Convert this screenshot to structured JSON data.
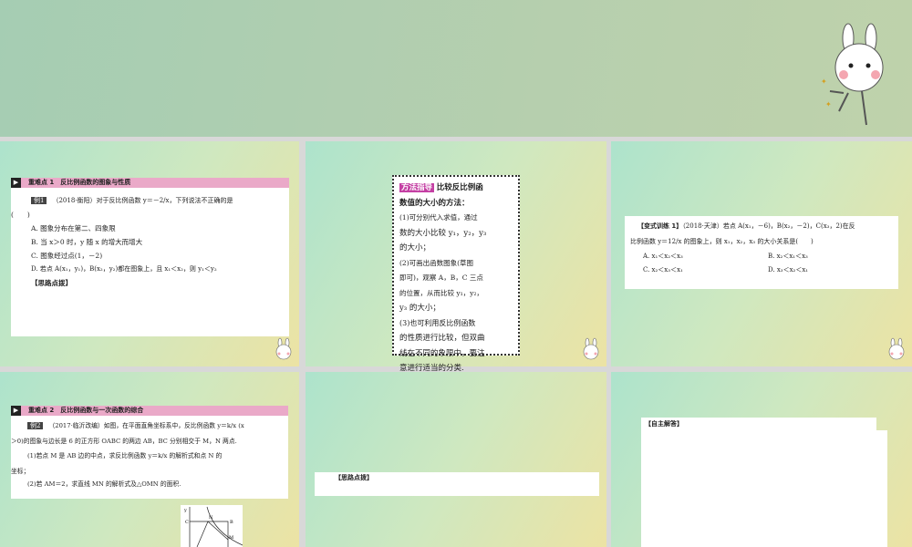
{
  "slide2": {
    "header": "重难点 1　反比例函数的图象与性质",
    "tag": "例1",
    "question": "（2018·衡阳）对于反比例函数 y＝－2/x，下列说法不正确的是",
    "blank": "(　　)",
    "options": [
      "A. 图象分布在第二、四象限",
      "B. 当 x＞0 时，y 随 x 的增大而增大",
      "C. 图象经过点(1，－2)",
      "D. 若点 A(x₁，y₁)，B(x₂，y₂)都在图象上，且 x₁＜x₂，则 y₁＜y₂"
    ],
    "hint": "【思路点拨】"
  },
  "slide3": {
    "title": "方法指导",
    "lines": [
      "比较反比例函",
      "数值的大小的方法：",
      "(1)可分别代入求值，通过",
      "数的大小比较 y₁，y₂，y₃",
      "的大小；",
      "(2)可画出函数图象(草图",
      "即可)，观察 A，B，C 三点",
      "的位置，从而比较 y₁，y₂，",
      "y₃ 的大小；",
      "(3)也可利用反比例函数",
      "的性质进行比较，但双曲",
      "线在不同的象限中，要注",
      "意进行适当的分类."
    ]
  },
  "slide4": {
    "label": "【变式训练 1】",
    "question": "（2018·天津）若点 A(x₁，－6)，B(x₂，－2)，C(x₃，2)在反",
    "question2": "比例函数 y＝12/x 的图象上，则 x₁，x₂，x₃ 的大小关系是(　　)",
    "options": [
      "A. x₁＜x₂＜x₃",
      "B. x₂＜x₁＜x₃",
      "C. x₂＜x₃＜x₁",
      "D. x₃＜x₂＜x₁"
    ]
  },
  "slide5": {
    "header": "重难点 2　反比例函数与一次函数的综合",
    "tag": "例2",
    "lines": [
      "（2017·临沂改编）如图，在平面直角坐标系中，反比例函数 y＝k/x (x",
      "＞0)的图象与边长是 6 的正方形 OABC 的两边 AB，BC 分别相交于 M，N 两点.",
      "(1)若点 M 是 AB 边的中点，求反比例函数 y＝k/x 的解析式和点 N 的",
      "坐标；",
      "(2)若 AM＝2，求直线 MN 的解析式及△OMN 的面积."
    ],
    "figure_labels": [
      "y",
      "C",
      "N",
      "B",
      "M"
    ]
  },
  "slide6": {
    "hint": "【思路点拨】"
  },
  "slide7": {
    "label": "【自主解答】"
  }
}
